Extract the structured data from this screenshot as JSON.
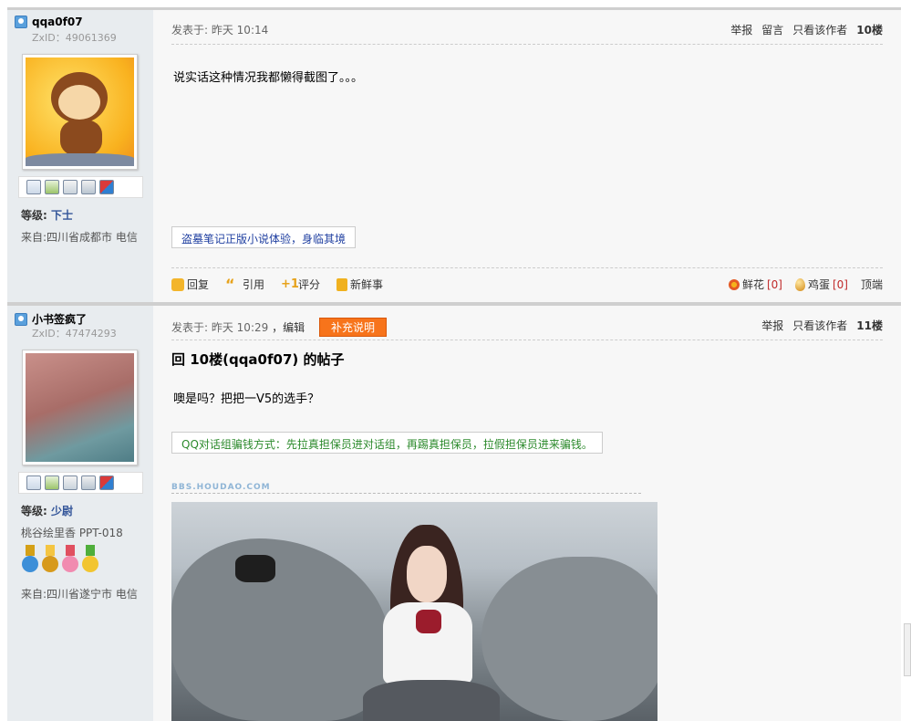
{
  "posts": [
    {
      "author": "qqa0f07",
      "uid": "ZxID：49061369",
      "rank_label": "等级:",
      "rank_value": "下士",
      "from": "来自:四川省成都市 电信",
      "meta": "发表于: 昨天 10:14",
      "actions": [
        "举报",
        "留言",
        "只看该作者"
      ],
      "floor": "10楼",
      "content": "说实话这种情况我都懒得截图了。。。",
      "ad": "盗墓笔记正版小说体验，身临其境",
      "bottom": {
        "reply": "回复",
        "quote": "引用",
        "rate": "评分",
        "news": "新鲜事",
        "flower_label": "鲜花",
        "flower_count": "[0]",
        "egg_label": "鸡蛋",
        "egg_count": "[0]",
        "top": "顶端"
      }
    },
    {
      "author": "小书签疯了",
      "uid": "ZxID：47474293",
      "rank_label": "等级:",
      "rank_value": "少尉",
      "signature": "桃谷绘里香 PPT-018",
      "from": "来自:四川省遂宁市 电信",
      "meta": "发表于: 昨天 10:29",
      "edit": "，编辑",
      "add_button": "补充说明",
      "actions": [
        "举报",
        "只看该作者"
      ],
      "floor": "11楼",
      "title": "回 10楼(qqa0f07) 的帖子",
      "content": "噢是吗？把把一V5的选手？",
      "ad": "QQ对话组骗钱方式：先拉真担保员进对话组，再踢真担保员，拉假担保员进来骗钱。",
      "watermark": "BBS.HOUDAO.COM"
    }
  ],
  "icons": {
    "sidebar": [
      "mail-icon",
      "add-friend-icon",
      "search-icon",
      "profile-icon",
      "blocks-icon"
    ],
    "medals": [
      "medal-blue",
      "medal-gold",
      "medal-pink",
      "medal-green"
    ]
  },
  "colors": {
    "floor": "#f26c00",
    "rank": "#335599",
    "add_button": "#f7741b",
    "ad_link_1": "#1f3fa0",
    "ad_link_2": "#2c8a2c"
  }
}
